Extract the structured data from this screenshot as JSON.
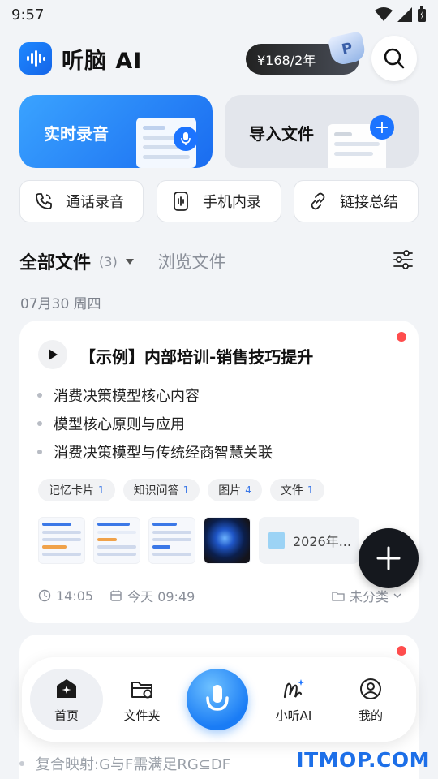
{
  "status": {
    "time": "9:57"
  },
  "header": {
    "app_name": "听脑 AI",
    "vip_price": "¥168/2年",
    "vip_medal": "P",
    "logo_icon": "waveform-icon",
    "search_icon": "search-icon"
  },
  "actions": {
    "record": "实时录音",
    "import": "导入文件"
  },
  "quick": {
    "call": "通话录音",
    "internal": "手机内录",
    "link": "链接总结"
  },
  "tabs": {
    "all": "全部文件",
    "count": "(3)",
    "browse": "浏览文件"
  },
  "date": "07月30  周四",
  "card": {
    "title": "【示例】内部培训-销售技巧提升",
    "bullets": [
      "消费决策模型核心内容",
      "模型核心原则与应用",
      "消费决策模型与传统经商智慧关联"
    ],
    "tags": [
      {
        "label": "记忆卡片",
        "count": "1"
      },
      {
        "label": "知识问答",
        "count": "1"
      },
      {
        "label": "图片",
        "count": "4"
      },
      {
        "label": "文件",
        "count": "1"
      }
    ],
    "file_name": "2026年...",
    "duration": "14:05",
    "time": "今天 09:49",
    "category": "未分类"
  },
  "card2": {
    "peek": "复合映射:G与F需满足RG⊆DF"
  },
  "nav": {
    "home": "首页",
    "folder": "文件夹",
    "assistant": "小听AI",
    "mine": "我的"
  },
  "watermark": "ITMOP.COM",
  "colors": {
    "accent": "#1c74ff",
    "dot": "#ff4d4d",
    "tag_count": "#3b78e7"
  }
}
